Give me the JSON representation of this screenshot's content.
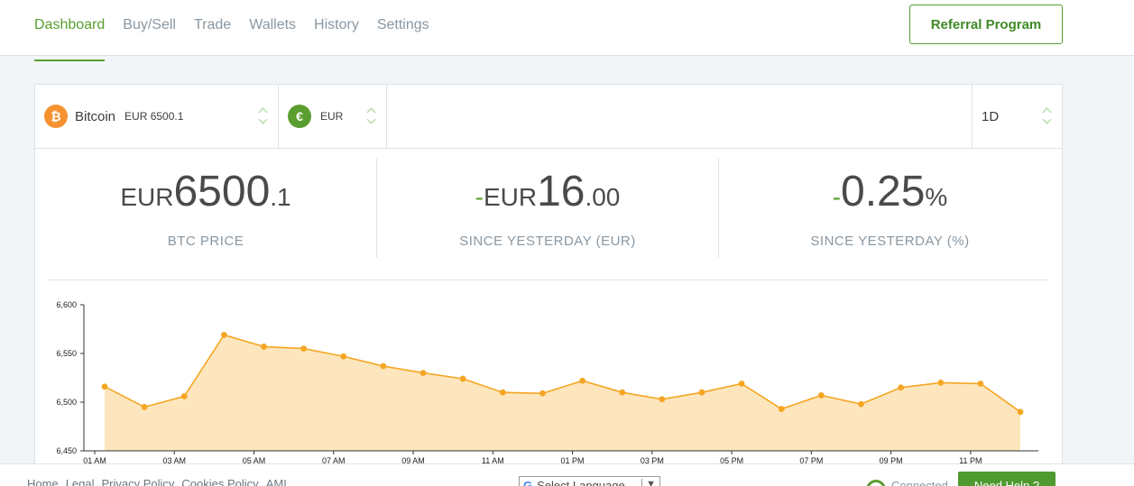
{
  "nav": {
    "items": [
      {
        "label": "Dashboard",
        "active": true
      },
      {
        "label": "Buy/Sell"
      },
      {
        "label": "Trade"
      },
      {
        "label": "Wallets"
      },
      {
        "label": "History"
      },
      {
        "label": "Settings"
      }
    ],
    "referral_label": "Referral Program"
  },
  "selectors": {
    "coin_icon": "₿",
    "coin_name": "Bitcoin",
    "coin_price": "EUR 6500.1",
    "currency_icon": "€",
    "currency": "EUR",
    "range": "1D"
  },
  "stats": {
    "price_prefix": "EUR",
    "price_int": "6500",
    "price_dec": ".1",
    "price_caption": "BTC PRICE",
    "change_sign": "-",
    "change_prefix": "EUR",
    "change_int": "16",
    "change_dec": ".00",
    "change_caption": "SINCE YESTERDAY (EUR)",
    "pct_sign": "-",
    "pct_value": "0.25",
    "pct_symbol": "%",
    "pct_caption": "SINCE YESTERDAY (%)"
  },
  "colors": {
    "accent": "#5a9e2f",
    "series_line": "#f5a623",
    "series_fill": "#fde6bd"
  },
  "chart_data": {
    "type": "area",
    "ylim": [
      6450,
      6600
    ],
    "yticks": [
      6450,
      6500,
      6550,
      6600
    ],
    "ytick_labels": [
      "6,450",
      "6,500",
      "6,550",
      "6,600"
    ],
    "xtick_labels": [
      "01 AM",
      "03 AM",
      "05 AM",
      "07 AM",
      "09 AM",
      "11 AM",
      "01 PM",
      "03 PM",
      "05 PM",
      "07 PM",
      "09 PM",
      "11 PM"
    ],
    "series": [
      {
        "values": [
          6516,
          6495,
          6506,
          6569,
          6557,
          6555,
          6547,
          6537,
          6530,
          6524,
          6510,
          6509,
          6522,
          6510,
          6503,
          6510,
          6519,
          6493,
          6507,
          6498,
          6515,
          6520,
          6519,
          6490
        ]
      }
    ]
  },
  "footer": {
    "links": [
      "Home",
      "Legal",
      "Privacy Policy",
      "Cookies Policy",
      "AML"
    ],
    "language_label": "Select Language",
    "status": "Connected",
    "help_label": "Need Help ?"
  }
}
